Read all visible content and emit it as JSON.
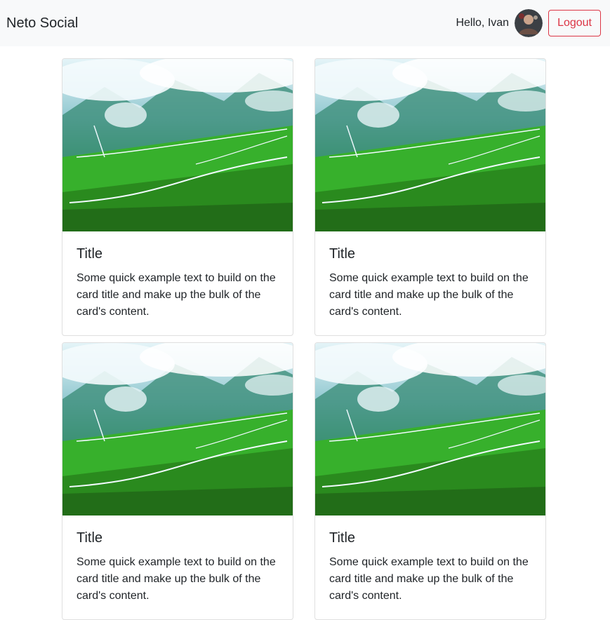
{
  "navbar": {
    "brand": "Neto Social",
    "greeting": "Hello, Ivan",
    "logout_label": "Logout",
    "avatar_icon": "user-avatar"
  },
  "colors": {
    "navbar_bg": "#f8f9fa",
    "logout": "#dc3545",
    "text": "#212529"
  },
  "cards": [
    {
      "title": "Title",
      "text": "Some quick example text to build on the card title and make up the bulk of the card's content.",
      "image_icon": "mountain-valley-image"
    },
    {
      "title": "Title",
      "text": "Some quick example text to build on the card title and make up the bulk of the card's content.",
      "image_icon": "mountain-valley-image"
    },
    {
      "title": "Title",
      "text": "Some quick example text to build on the card title and make up the bulk of the card's content.",
      "image_icon": "mountain-valley-image"
    },
    {
      "title": "Title",
      "text": "Some quick example text to build on the card title and make up the bulk of the card's content.",
      "image_icon": "mountain-valley-image"
    }
  ]
}
